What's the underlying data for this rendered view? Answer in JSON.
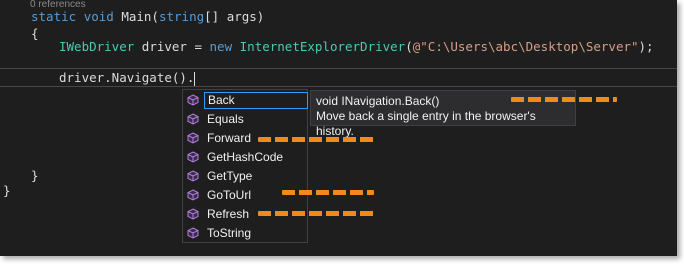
{
  "editor": {
    "references": "0 references",
    "line1": {
      "kw1": "static",
      "kw2": "void",
      "name": "Main(",
      "kw3": "string",
      "rest": "[] args)"
    },
    "brace_open": "{",
    "line3": {
      "type1": "IWebDriver",
      "mid": " driver = ",
      "kw": "new",
      "type2": "InternetExplorerDriver",
      "open": "(",
      "str": "@\"C:\\Users\\abc\\Desktop\\Server\"",
      "close": ");"
    },
    "line4": "driver.Navigate().",
    "brace_inner_close": "}",
    "brace_outer_close": "}"
  },
  "intellisense": {
    "items": [
      "Back",
      "Equals",
      "Forward",
      "GetHashCode",
      "GetType",
      "GoToUrl",
      "Refresh",
      "ToString"
    ],
    "selected": "Back",
    "icon": "method-cube-icon"
  },
  "tooltip": {
    "signature": "void INavigation.Back()",
    "description": "Move back a single entry in the browser's history."
  },
  "colors": {
    "background": "#1e1e1e",
    "keyword": "#569cd6",
    "type": "#4ec9b0",
    "string": "#d69d85",
    "method_icon": "#b180d7",
    "highlight_dashes": "#f28a1b"
  }
}
